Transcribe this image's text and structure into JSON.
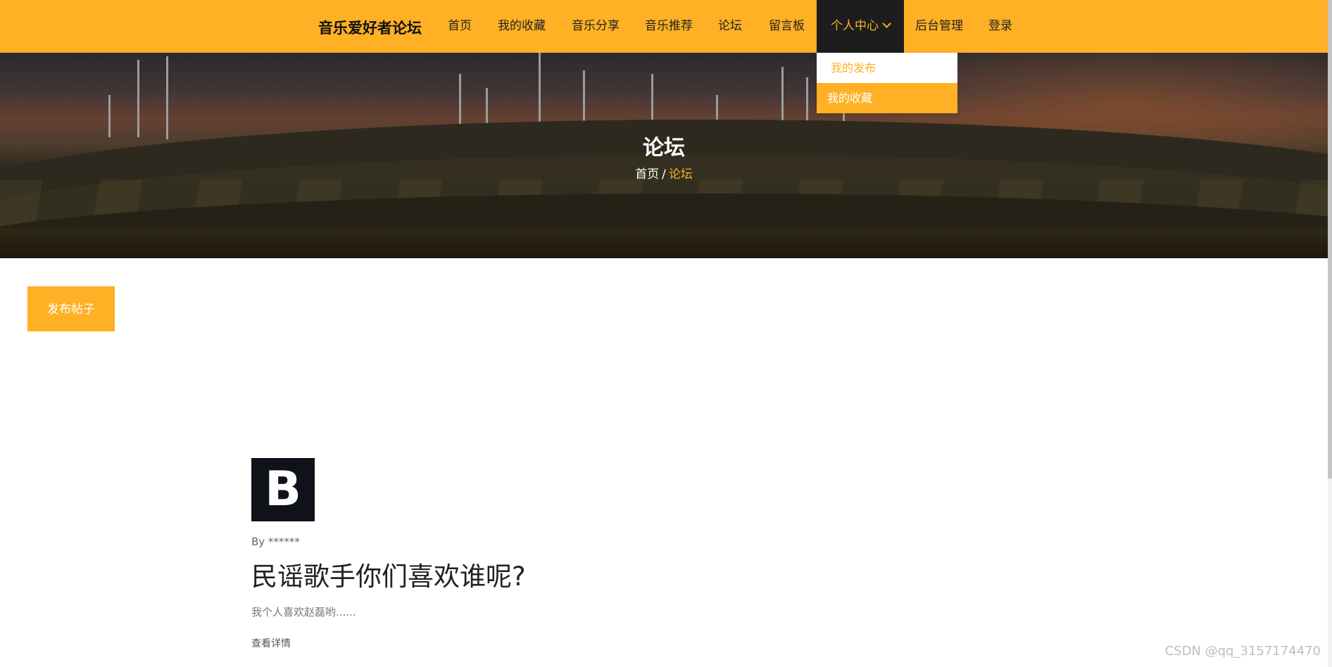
{
  "nav": {
    "brand": "音乐爱好者论坛",
    "items": [
      {
        "label": "首页"
      },
      {
        "label": "我的收藏"
      },
      {
        "label": "音乐分享"
      },
      {
        "label": "音乐推荐"
      },
      {
        "label": "论坛"
      },
      {
        "label": "留言板"
      },
      {
        "label": "个人中心"
      },
      {
        "label": "后台管理"
      },
      {
        "label": "登录"
      }
    ],
    "active_index": 6,
    "dropdown": [
      {
        "label": "我的发布"
      },
      {
        "label": "我的收藏"
      }
    ]
  },
  "hero": {
    "title": "论坛",
    "breadcrumb_home": "首页",
    "breadcrumb_sep": "/",
    "breadcrumb_current": "论坛"
  },
  "actions": {
    "post_button": "发布帖子"
  },
  "posts": [
    {
      "thumb_letter": "B",
      "author": "By ******",
      "title": "民谣歌手你们喜欢谁呢?",
      "excerpt": "我个人喜欢赵磊哟......",
      "more": "查看详情"
    }
  ],
  "watermark": "CSDN @qq_3157174470",
  "colors": {
    "accent": "#ffb024",
    "nav_active_bg": "#1d1d1d",
    "text_dark": "#222222"
  }
}
